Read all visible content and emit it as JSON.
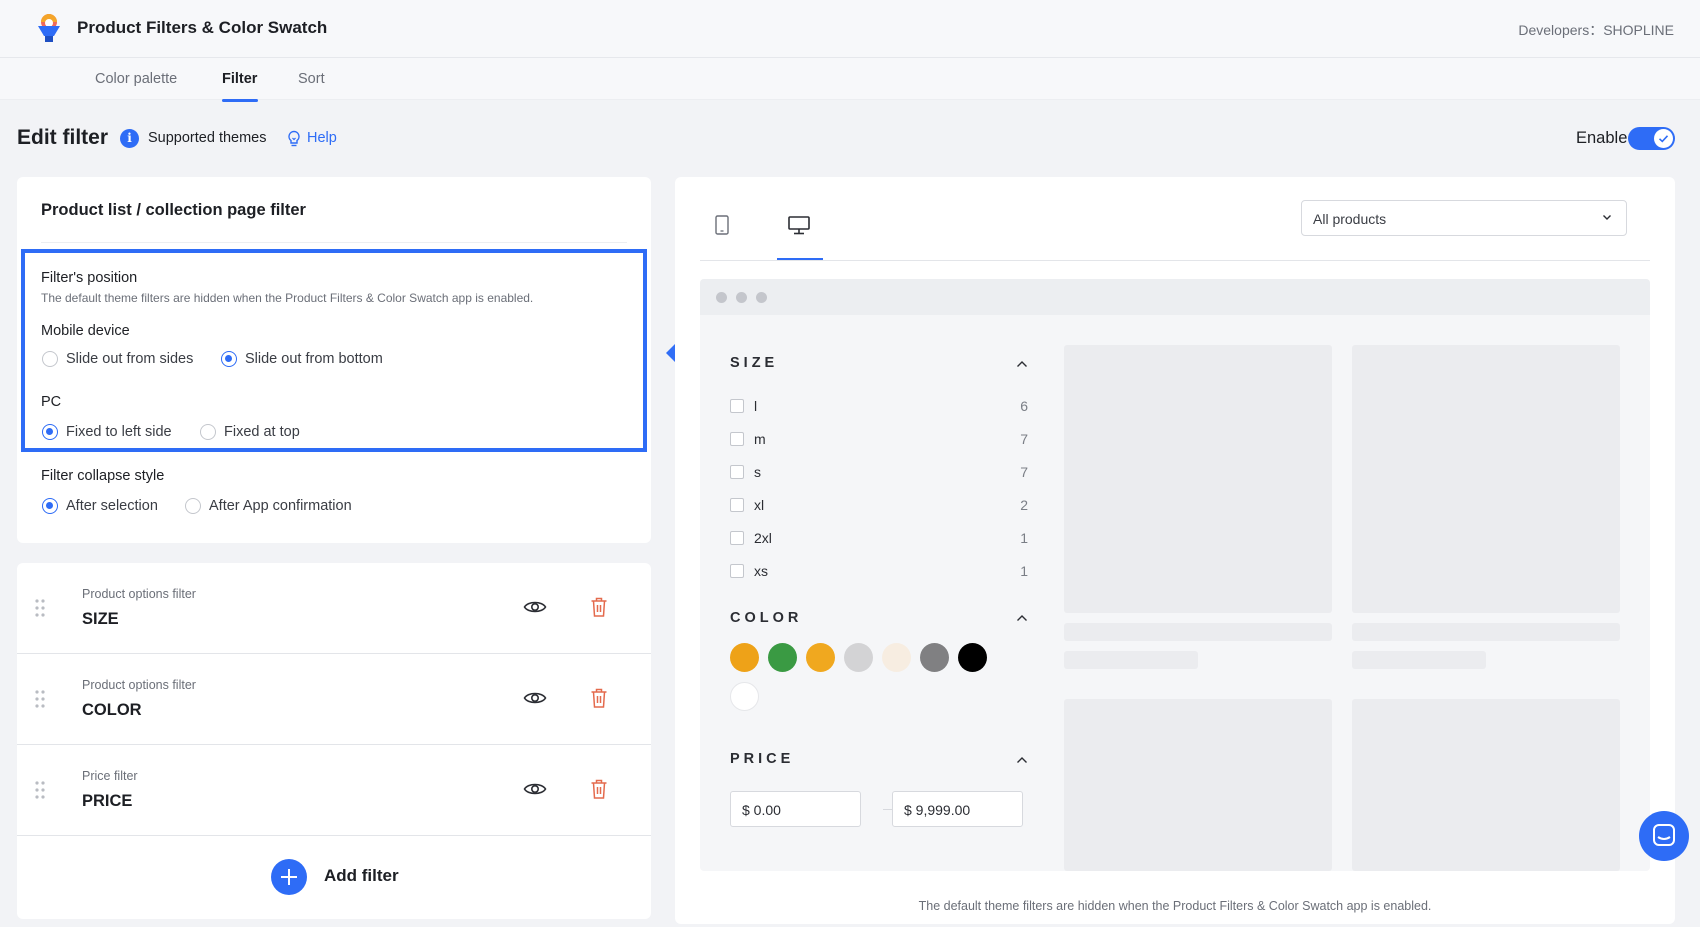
{
  "app": {
    "title": "Product Filters & Color Swatch",
    "developer": "Developers：SHOPLINE"
  },
  "tabs": [
    {
      "label": "Color palette"
    },
    {
      "label": "Filter",
      "active": true
    },
    {
      "label": "Sort"
    }
  ],
  "header": {
    "title": "Edit filter",
    "supported": "Supported themes",
    "help": "Help",
    "enable_label": "Enable",
    "enabled": true
  },
  "settings": {
    "title": "Product list / collection page filter",
    "position_label": "Filter's position",
    "position_desc": "The default theme filters are hidden when the Product Filters & Color Swatch app is enabled.",
    "mobile_label": "Mobile device",
    "mobile_options": [
      "Slide out from sides",
      "Slide out from bottom"
    ],
    "mobile_selected": "Slide out from bottom",
    "pc_label": "PC",
    "pc_options": [
      "Fixed to left side",
      "Fixed at top"
    ],
    "pc_selected": "Fixed to left side",
    "collapse_label": "Filter collapse style",
    "collapse_options": [
      "After selection",
      "After App confirmation"
    ],
    "collapse_selected": "After selection"
  },
  "filters": [
    {
      "type": "Product options filter",
      "name": "SIZE"
    },
    {
      "type": "Product options filter",
      "name": "COLOR"
    },
    {
      "type": "Price filter",
      "name": "PRICE"
    }
  ],
  "add_filter": "Add filter",
  "preview": {
    "select_value": "All products",
    "size_title": "SIZE",
    "size_options": [
      {
        "label": "l",
        "count": "6"
      },
      {
        "label": "m",
        "count": "7"
      },
      {
        "label": "s",
        "count": "7"
      },
      {
        "label": "xl",
        "count": "2"
      },
      {
        "label": "2xl",
        "count": "1"
      },
      {
        "label": "xs",
        "count": "1"
      }
    ],
    "color_title": "COLOR",
    "swatches": [
      "#eea218",
      "#3a9a43",
      "#f0a81f",
      "#d3d3d5",
      "#f7ede1",
      "#808082",
      "#000000",
      "#ffffff"
    ],
    "price_title": "PRICE",
    "price_min": "$ 0.00",
    "price_max": "$ 9,999.00",
    "footer": "The default theme filters are hidden when the Product Filters & Color Swatch app is enabled."
  },
  "colors": {
    "accent": "#2e6cf6",
    "danger": "#e46a4d"
  }
}
